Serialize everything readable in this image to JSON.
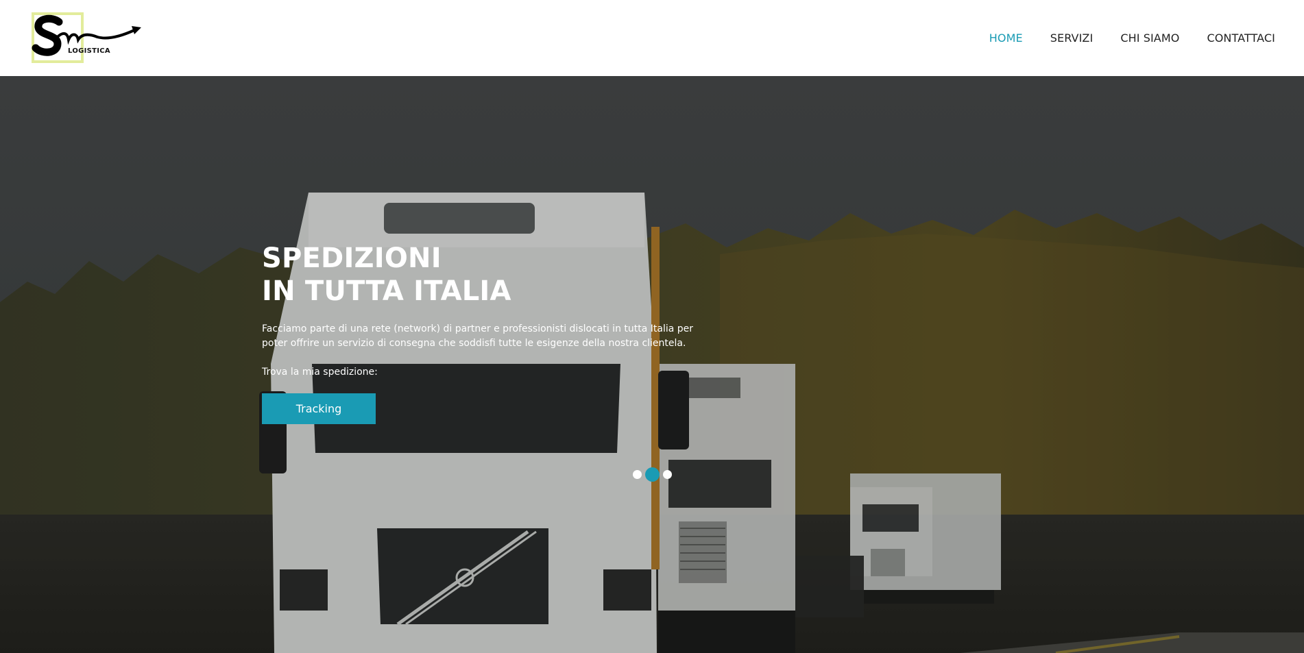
{
  "brand": {
    "logo_text": "LOGISTICA",
    "logo_icon": "sm-swoosh-arrow-logo",
    "accent_color": "#1a9bb4",
    "logo_frame_color": "#e2ec9b"
  },
  "nav": {
    "items": [
      {
        "label": "HOME",
        "active": true
      },
      {
        "label": "SERVIZI",
        "active": false
      },
      {
        "label": "CHI SIAMO",
        "active": false
      },
      {
        "label": "CONTATTACI",
        "active": false
      }
    ]
  },
  "hero": {
    "title_line1": "SPEDIZIONI",
    "title_line2": "IN TUTTA ITALIA",
    "description": "Facciamo parte di una rete (network) di partner e professionisti dislocati in tutta Italia per poter offrire un servizio di consegna che soddisfi tutte le esigenze della nostra clientela.",
    "find_label": "Trova la mia spedizione:",
    "tracking_button": "Tracking",
    "background_image": "trucks-on-road-forest-photo",
    "slider": {
      "slides": 3,
      "active_slide": 2
    }
  }
}
